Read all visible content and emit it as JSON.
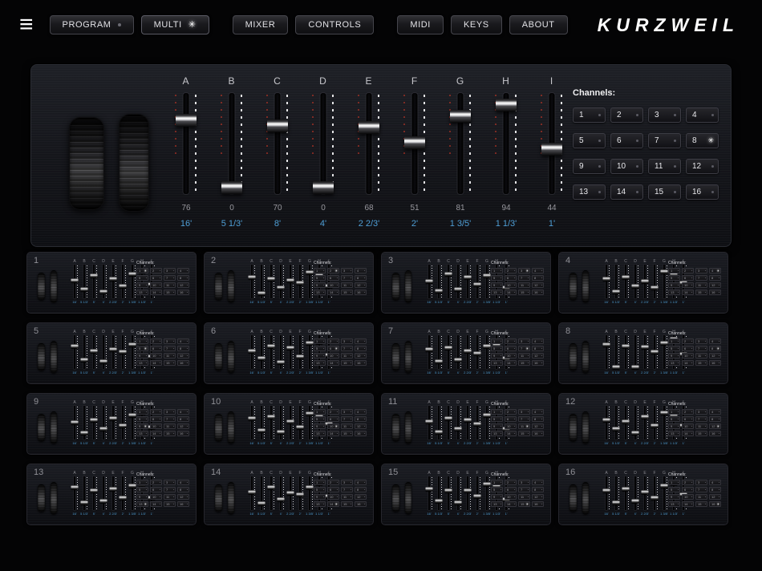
{
  "icons": {
    "menu": "≡",
    "star": "✳",
    "dot": "•"
  },
  "colors": {
    "accent_blue": "#4f9fd6",
    "led_white": "#e4e4e6",
    "led_red": "#cd3726",
    "star_white": "#ffffff"
  },
  "topbar": {
    "buttons": [
      {
        "label": "PROGRAM",
        "indicator": "dot",
        "group": 1,
        "active": false
      },
      {
        "label": "MULTI",
        "indicator": "star",
        "group": 1,
        "active": true
      },
      {
        "label": "MIXER",
        "indicator": null,
        "group": 2,
        "active": false
      },
      {
        "label": "CONTROLS",
        "indicator": null,
        "group": 2,
        "active": false
      },
      {
        "label": "MIDI",
        "indicator": null,
        "group": 3,
        "active": false
      },
      {
        "label": "KEYS",
        "indicator": null,
        "group": 3,
        "active": false
      },
      {
        "label": "ABOUT",
        "indicator": null,
        "group": 3,
        "active": false
      }
    ],
    "logo": "KURZWEIL"
  },
  "main_panel": {
    "drawbars": {
      "labels": [
        "A",
        "B",
        "C",
        "D",
        "E",
        "F",
        "G",
        "H",
        "I"
      ],
      "values": [
        76,
        0,
        70,
        0,
        68,
        51,
        81,
        94,
        44
      ],
      "footages": [
        "16'",
        "5 1/3'",
        "8'",
        "4'",
        "2 2/3'",
        "2'",
        "1 3/5'",
        "1 1/3'",
        "1'"
      ]
    },
    "channels": {
      "label": "Channels:",
      "numbers": [
        1,
        2,
        3,
        4,
        5,
        6,
        7,
        8,
        9,
        10,
        11,
        12,
        13,
        14,
        15,
        16
      ],
      "selected": 8
    }
  },
  "minis": [
    {
      "number": 1,
      "values": [
        55,
        25,
        70,
        15,
        60,
        35,
        75,
        85,
        40
      ],
      "selected_channel": 1
    },
    {
      "number": 2,
      "values": [
        65,
        10,
        60,
        30,
        55,
        45,
        80,
        70,
        35
      ],
      "selected_channel": 2
    },
    {
      "number": 3,
      "values": [
        50,
        20,
        75,
        25,
        65,
        40,
        70,
        90,
        30
      ],
      "selected_channel": 3
    },
    {
      "number": 4,
      "values": [
        60,
        15,
        65,
        35,
        50,
        30,
        85,
        75,
        45
      ],
      "selected_channel": 4
    },
    {
      "number": 5,
      "values": [
        70,
        25,
        55,
        20,
        60,
        50,
        75,
        80,
        35
      ],
      "selected_channel": 5
    },
    {
      "number": 6,
      "values": [
        55,
        30,
        70,
        15,
        65,
        35,
        80,
        85,
        40
      ],
      "selected_channel": 6
    },
    {
      "number": 7,
      "values": [
        60,
        20,
        65,
        25,
        55,
        45,
        70,
        75,
        30
      ],
      "selected_channel": 7
    },
    {
      "number": 8,
      "values": [
        76,
        0,
        70,
        0,
        68,
        51,
        81,
        94,
        44
      ],
      "selected_channel": 8
    },
    {
      "number": 9,
      "values": [
        50,
        15,
        60,
        30,
        65,
        40,
        75,
        85,
        35
      ],
      "selected_channel": 9
    },
    {
      "number": 10,
      "values": [
        65,
        25,
        70,
        20,
        55,
        35,
        80,
        70,
        45
      ],
      "selected_channel": 10
    },
    {
      "number": 11,
      "values": [
        55,
        20,
        65,
        30,
        60,
        45,
        75,
        90,
        30
      ],
      "selected_channel": 11
    },
    {
      "number": 12,
      "values": [
        60,
        30,
        55,
        15,
        70,
        40,
        85,
        75,
        40
      ],
      "selected_channel": 12
    },
    {
      "number": 13,
      "values": [
        70,
        20,
        60,
        25,
        65,
        35,
        75,
        80,
        35
      ],
      "selected_channel": 13
    },
    {
      "number": 14,
      "values": [
        55,
        15,
        70,
        30,
        50,
        45,
        70,
        85,
        40
      ],
      "selected_channel": 14
    },
    {
      "number": 15,
      "values": [
        65,
        25,
        60,
        20,
        60,
        40,
        80,
        75,
        30
      ],
      "selected_channel": 15
    },
    {
      "number": 16,
      "values": [
        60,
        20,
        65,
        25,
        55,
        35,
        75,
        85,
        45
      ],
      "selected_channel": 16
    }
  ]
}
